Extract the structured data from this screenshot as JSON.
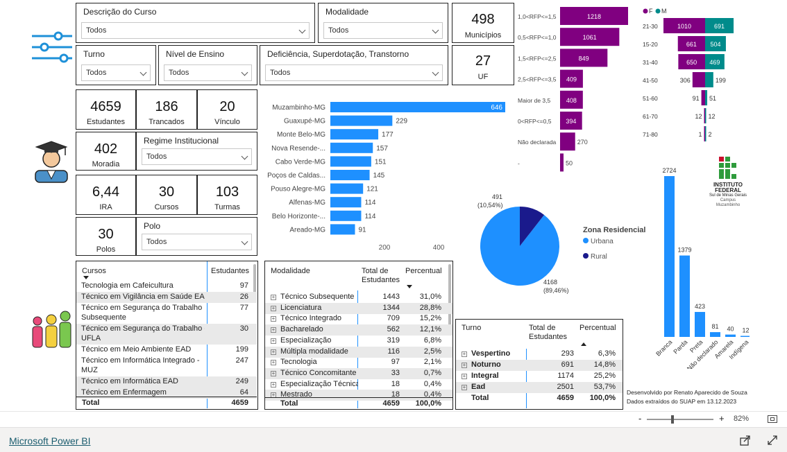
{
  "filters": {
    "curso": {
      "label": "Descrição do Curso",
      "value": "Todos"
    },
    "modalidade": {
      "label": "Modalidade",
      "value": "Todos"
    },
    "turno": {
      "label": "Turno",
      "value": "Todos"
    },
    "nivel": {
      "label": "Nível de Ensino",
      "value": "Todos"
    },
    "deficiencia": {
      "label": "Deficiência, Superdotação, Transtorno",
      "value": "Todos"
    },
    "regime": {
      "label": "Regime Institucional",
      "value": "Todos"
    },
    "polo": {
      "label": "Polo",
      "value": "Todos"
    }
  },
  "cards": {
    "municipios": {
      "value": "498",
      "label": "Municípios"
    },
    "uf": {
      "value": "27",
      "label": "UF"
    },
    "estudantes": {
      "value": "4659",
      "label": "Estudantes"
    },
    "trancados": {
      "value": "186",
      "label": "Trancados"
    },
    "vinculo": {
      "value": "20",
      "label": "Vínculo"
    },
    "moradia": {
      "value": "402",
      "label": "Moradia"
    },
    "ira": {
      "value": "6,44",
      "label": "IRA"
    },
    "cursos": {
      "value": "30",
      "label": "Cursos"
    },
    "turmas": {
      "value": "103",
      "label": "Turmas"
    },
    "polos": {
      "value": "30",
      "label": "Polos"
    }
  },
  "icons": {
    "filter": "sliders-icon",
    "student": "graduate-icon",
    "people": "people-icon",
    "logo": "institute-logo"
  },
  "logo_text": {
    "line1": "INSTITUTO",
    "line2": "FEDERAL",
    "line3": "Sul de Minas Gerais",
    "line4": "Campus",
    "line5": "Muzambinho"
  },
  "cursos_table": {
    "headers": [
      "Cursos",
      "Estudantes"
    ],
    "rows": [
      [
        "Tecnologia em Cafeicultura",
        "97"
      ],
      [
        "Técnico em Vigilância em Saúde EAD",
        "26"
      ],
      [
        "Técnico em Segurança do Trabalho",
        "77"
      ],
      [
        "Subsequente",
        ""
      ],
      [
        "Técnico em Segurança do Trabalho -",
        "30"
      ],
      [
        "UFLA",
        ""
      ],
      [
        "Técnico em Meio Ambiente EAD",
        "199"
      ],
      [
        "Técnico em Informática Integrado -",
        "247"
      ],
      [
        "MUZ",
        ""
      ],
      [
        "Técnico em Informática EAD",
        "249"
      ],
      [
        "Técnico em Enfermagem",
        "64"
      ]
    ],
    "total_label": "Total",
    "total_value": "4659"
  },
  "modalidade_table": {
    "headers": [
      "Modalidade",
      "Total de Estudantes",
      "Percentual"
    ],
    "rows": [
      [
        "Técnico Subsequente",
        "1443",
        "31,0%"
      ],
      [
        "Licenciatura",
        "1344",
        "28,8%"
      ],
      [
        "Técnico Integrado",
        "709",
        "15,2%"
      ],
      [
        "Bacharelado",
        "562",
        "12,1%"
      ],
      [
        "Especialização",
        "319",
        "6,8%"
      ],
      [
        "Múltipla modalidade",
        "116",
        "2,5%"
      ],
      [
        "Tecnologia",
        "97",
        "2,1%"
      ],
      [
        "Técnico Concomitante",
        "33",
        "0,7%"
      ],
      [
        "Especialização Técnica",
        "18",
        "0,4%"
      ],
      [
        "Mestrado",
        "18",
        "0,4%"
      ]
    ],
    "total": [
      "Total",
      "4659",
      "100,0%"
    ]
  },
  "turno_table": {
    "headers": [
      "Turno",
      "Total de Estudantes",
      "Percentual"
    ],
    "rows": [
      [
        "Vespertino",
        "293",
        "6,3%"
      ],
      [
        "Noturno",
        "691",
        "14,8%"
      ],
      [
        "Integral",
        "1174",
        "25,2%"
      ],
      [
        "Ead",
        "2501",
        "53,7%"
      ]
    ],
    "total": [
      "Total",
      "4659",
      "100,0%"
    ]
  },
  "credits": {
    "line1": "Desenvolvido por Renato Aparecido de Souza",
    "line2": "Dados extraídos do SUAP em 13.12.2023"
  },
  "footer": {
    "brand": "Microsoft Power BI",
    "zoom": "82%",
    "minus": "-",
    "plus": "+"
  },
  "chart_data": [
    {
      "type": "bar",
      "orientation": "horizontal",
      "categories": [
        "Muzambinho-MG",
        "Guaxupé-MG",
        "Monte Belo-MG",
        "Nova Resende-...",
        "Cabo Verde-MG",
        "Poços de Caldas...",
        "Pouso Alegre-MG",
        "Alfenas-MG",
        "Belo Horizonte-...",
        "Areado-MG"
      ],
      "values": [
        646,
        229,
        177,
        157,
        151,
        145,
        121,
        114,
        114,
        91
      ],
      "xticks": [
        "200",
        "400"
      ],
      "xlim": [
        0,
        600
      ],
      "color": "#1e90ff"
    },
    {
      "type": "bar",
      "orientation": "horizontal",
      "categories": [
        "1,0<RFP<=1,5",
        "0,5<RFP<=1,0",
        "1,5<RFP<=2,5",
        "2,5<RFP<=3,5",
        "Maior de 3,5",
        "0<RFP<=0,5",
        "Não declarada",
        "-"
      ],
      "values": [
        1218,
        1061,
        849,
        409,
        408,
        394,
        270,
        50
      ],
      "color": "#800080"
    },
    {
      "type": "bar",
      "orientation": "horizontal",
      "stacked": "diverging",
      "categories": [
        "21-30",
        "15-20",
        "31-40",
        "41-50",
        "51-60",
        "61-70",
        "71-80"
      ],
      "series": [
        {
          "name": "F",
          "values": [
            1010,
            661,
            650,
            306,
            91,
            12,
            1
          ],
          "color": "#800080"
        },
        {
          "name": "M",
          "values": [
            691,
            504,
            469,
            199,
            51,
            12,
            2
          ],
          "color": "#008B8B"
        }
      ],
      "legend": "top-left"
    },
    {
      "type": "pie",
      "title": "Zona Residencial",
      "labels": [
        "Urbana",
        "Rural"
      ],
      "values": [
        4168,
        491
      ],
      "value_labels": [
        "4168\n(89,46%)",
        "491\n(10,54%)"
      ],
      "colors": [
        "#1e90ff",
        "#1a1a8c"
      ],
      "legend": "right"
    },
    {
      "type": "bar",
      "categories": [
        "Branca",
        "Parda",
        "Preta",
        "Não declarado",
        "Amarela",
        "Indígena"
      ],
      "values": [
        2724,
        1379,
        423,
        81,
        40,
        12
      ],
      "color": "#1e90ff"
    }
  ]
}
